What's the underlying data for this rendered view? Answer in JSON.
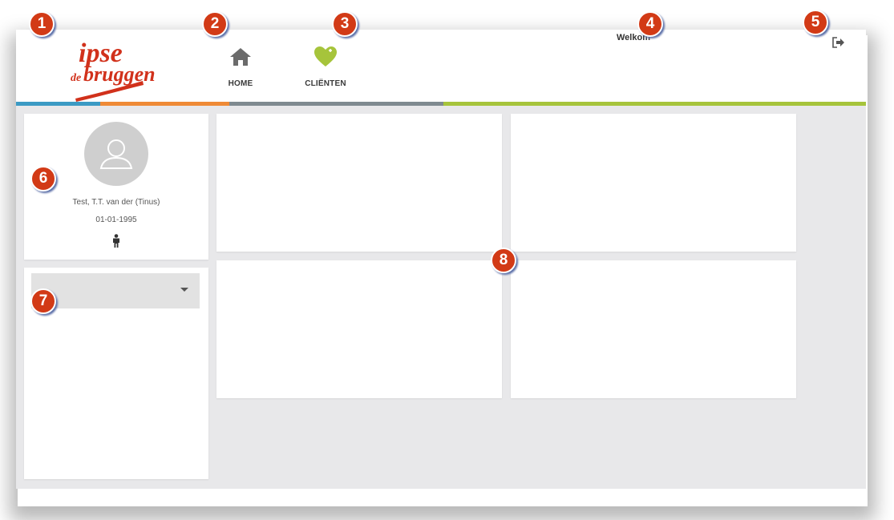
{
  "header": {
    "welcome_text": "Welkom",
    "nav": [
      {
        "label": "HOME",
        "icon": "home-icon"
      },
      {
        "label": "CLIËNTEN",
        "icon": "heart-plus-icon"
      }
    ],
    "logout_icon": "logout-icon"
  },
  "logo": {
    "line1": "ipse",
    "line2_small": "de",
    "line2": "bruggen"
  },
  "colors": {
    "accent_blue": "#3b9ac4",
    "accent_orange": "#ef8a36",
    "accent_gray": "#7f8a90",
    "accent_green": "#a6c43b",
    "logo_red": "#d1311b"
  },
  "profile": {
    "name": "Test, T.T. van der  (Tinus)",
    "dob": "01-01-1995",
    "gender_icon": "male-person-icon"
  },
  "dropdown": {
    "value": ""
  },
  "markers": [
    "1",
    "2",
    "3",
    "4",
    "5",
    "6",
    "7",
    "8"
  ]
}
